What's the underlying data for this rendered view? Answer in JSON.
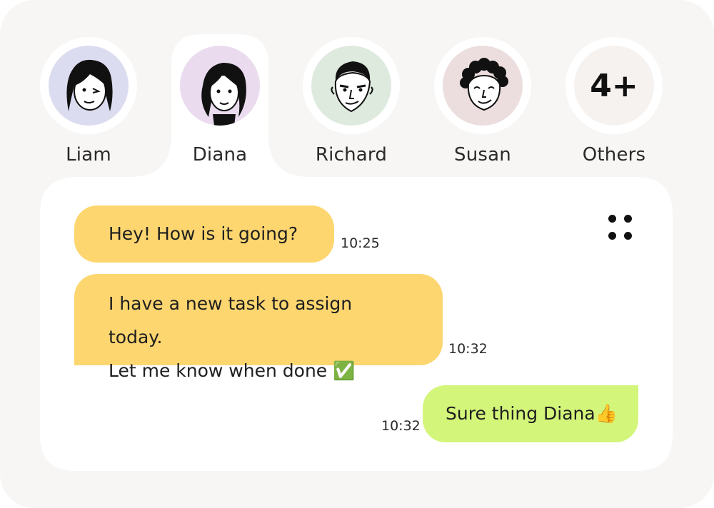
{
  "contacts": [
    {
      "name": "Liam",
      "avatar": "liam-avatar",
      "bg": "#dcdcf0",
      "selected": false
    },
    {
      "name": "Diana",
      "avatar": "diana-avatar",
      "bg": "#eadbef",
      "selected": true
    },
    {
      "name": "Richard",
      "avatar": "richard-avatar",
      "bg": "#dfeadf",
      "selected": false
    },
    {
      "name": "Susan",
      "avatar": "susan-avatar",
      "bg": "#ecdede",
      "selected": false
    },
    {
      "name": "Others",
      "count_label": "4+",
      "bg": "#f6f2f0",
      "selected": false
    }
  ],
  "messages": [
    {
      "direction": "incoming",
      "lines": [
        "Hey! How is it going?"
      ],
      "time": "10:25"
    },
    {
      "direction": "incoming",
      "lines": [
        "I have a new task to assign today.",
        "Let me know when done ✅"
      ],
      "time": "10:32"
    },
    {
      "direction": "outgoing",
      "lines": [
        "Sure thing Diana👍"
      ],
      "time": "10:32"
    }
  ],
  "menu": {
    "icon": "four-dots-menu-icon"
  },
  "colors": {
    "background": "#f7f6f4",
    "panel": "#ffffff",
    "incoming_bubble": "#fdd670",
    "outgoing_bubble": "#d3f57a"
  }
}
